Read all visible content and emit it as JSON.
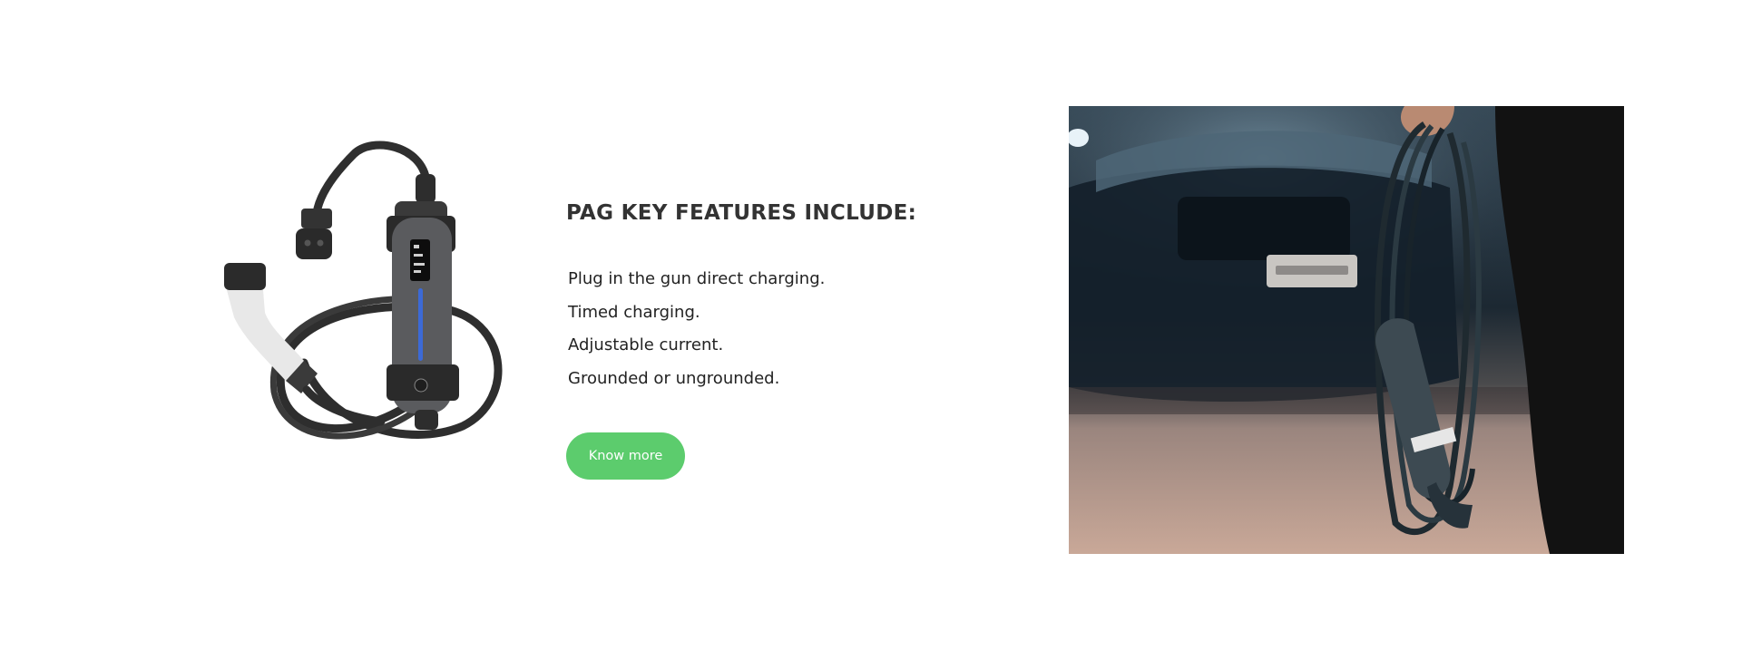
{
  "features": {
    "heading": "PAG KEY FEATURES INCLUDE:",
    "items": [
      "Plug in the gun direct charging.",
      "Timed charging.",
      "Adjustable current.",
      "Grounded or ungrounded."
    ],
    "button_label": "Know more"
  },
  "colors": {
    "accent": "#5ccc6d",
    "text": "#222222",
    "background": "#ffffff"
  }
}
